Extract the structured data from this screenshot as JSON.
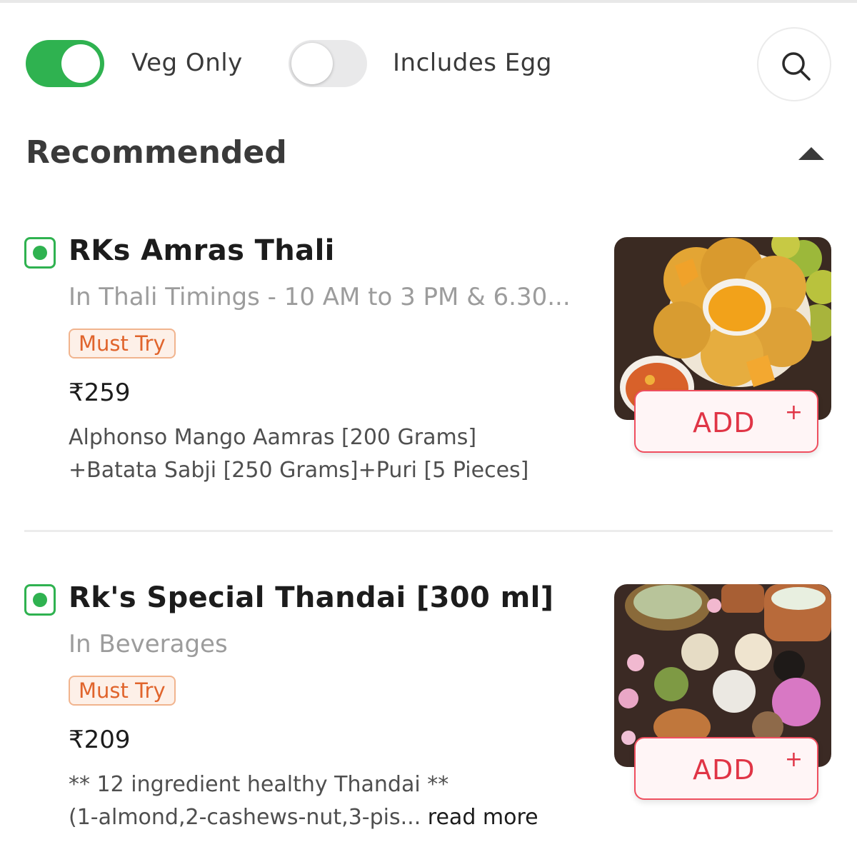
{
  "filters": {
    "veg_only": {
      "label": "Veg Only",
      "enabled": true
    },
    "includes_egg": {
      "label": "Includes Egg",
      "enabled": false
    }
  },
  "search": {
    "icon": "search-icon"
  },
  "section": {
    "title": "Recommended",
    "collapse_icon": "caret-up-icon"
  },
  "colors": {
    "veg_green": "#2fb250",
    "add_red": "#e03546",
    "badge_orange": "#e0642c"
  },
  "items": [
    {
      "name": "RKs Amras Thali",
      "category": "In Thali Timings - 10 AM to 3 PM & 6.30...",
      "badge": "Must Try",
      "price": "₹259",
      "description_line1": "Alphonso Mango Aamras [200 Grams]",
      "description_line2": "+Batata Sabji [250 Grams]+Puri [5 Pieces]",
      "add_label": "ADD",
      "add_plus": "+"
    },
    {
      "name": "Rk's Special Thandai [300 ml]",
      "category": "In Beverages",
      "badge": "Must Try",
      "price": "₹209",
      "description_line1": "** 12 ingredient healthy Thandai **",
      "description_line2": "(1-almond,2-cashews-nut,3-pis...",
      "read_more": "read more",
      "add_label": "ADD",
      "add_plus": "+"
    }
  ]
}
